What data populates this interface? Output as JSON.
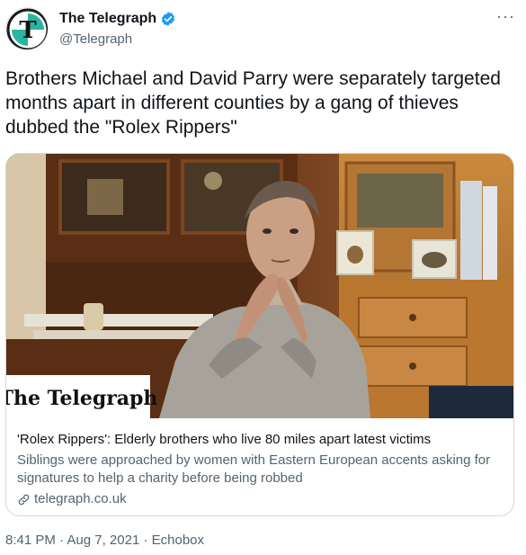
{
  "author": {
    "name": "The Telegraph",
    "handle": "@Telegraph",
    "more_label": "···",
    "verified_color": "#1d9bf0"
  },
  "tweet": {
    "text": "Brothers Michael and David Parry were separately targeted months apart in different counties by a gang of thieves dubbed the \"Rolex Rippers\""
  },
  "card": {
    "image_logo": "The Telegraph",
    "title": "'Rolex Rippers': Elderly brothers who live 80 miles apart latest victims",
    "description": "Siblings were approached by women with Eastern European accents asking for signatures to help a charity before being robbed",
    "domain": "telegraph.co.uk"
  },
  "meta": {
    "time": "8:41 PM",
    "date": "Aug 7, 2021",
    "source": "Echobox",
    "separator": " · "
  },
  "colors": {
    "text_primary": "#0f1419",
    "text_secondary": "#536471",
    "border": "#cfd9de"
  }
}
